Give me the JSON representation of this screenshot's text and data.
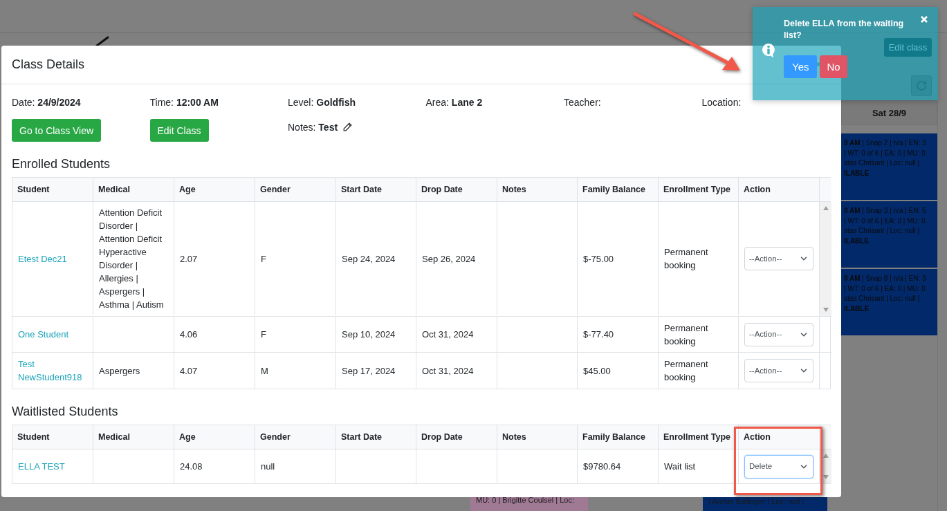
{
  "background": {
    "edit_button": "Edit class",
    "day_header": "Sat 28/9",
    "events": [
      {
        "time": "0 AM",
        "details": "| Snap 2 | n/a | EN: 3",
        "lines": [
          "| WT: 0 of 6 | EA: 0 | MU: 0",
          "stas Chrisant | Loc: null |"
        ],
        "status": "ILABLE",
        "color": "#02296a"
      },
      {
        "time": "0 AM",
        "details": "| Snap 3 | n/a | EN: 5",
        "lines": [
          "| WT: 0 of 6 | EA: 0 | MU: 0",
          "stas Chrisant | Loc: null |"
        ],
        "status": "ILABLE",
        "color": "#02296a"
      },
      {
        "time": "0 AM",
        "details": "| Snap 8 | n/a | EN: 3",
        "lines": [
          "| WT: 0 of 6 | EA: 0 | MU: 0",
          "stas Chrisant | Loc: null |"
        ],
        "status": "ILABLE",
        "color": "#02296a"
      }
    ],
    "bottom_events": [
      {
        "text": "MU: 0 | Brigitte Coulsel | Loc:",
        "color": "#a07a95"
      },
      {
        "text": "| Archie Ballinger | Loc: null |",
        "color": "#02296a"
      }
    ]
  },
  "modal": {
    "title": "Class Details",
    "details": [
      "Date: **24/9/2024**",
      "Time: **12:00 AM**",
      "Level: **Goldfish**",
      "Area: **Lane 2**",
      "Teacher:",
      "Location:"
    ],
    "buttons": [
      "Go to Class View",
      "Edit Class"
    ],
    "notes": "Notes: **Test**",
    "enrolled": {
      "title": "Enrolled Students",
      "columns": [
        "Student",
        "Medical",
        "Age",
        "Gender",
        "Start Date",
        "Drop Date",
        "Notes",
        "Family Balance",
        "Enrollment Type",
        "Action"
      ],
      "rows": [
        {
          "student": "Etest Dec21",
          "medical": "Attention Deficit Disorder | Attention Deficit Hyperactive Disorder | Allergies | Aspergers | Asthma | Autism",
          "age": "2.07",
          "gender": "F",
          "start_date": "Sep 24, 2024",
          "drop_date": "Sep 26, 2024",
          "family_balance": "$-75.00",
          "enrollment_type": "Permanent booking",
          "action": {
            "value": "--Action--",
            "focused": false
          }
        },
        {
          "student": "One Student",
          "age": "4.06",
          "gender": "F",
          "start_date": "Sep 10, 2024",
          "drop_date": "Oct 31, 2024",
          "family_balance": "$-77.40",
          "enrollment_type": "Permanent booking",
          "action": {
            "value": "--Action--",
            "focused": false
          }
        },
        {
          "student": "Test NewStudent918",
          "medical": "Aspergers",
          "age": "4.07",
          "gender": "M",
          "start_date": "Sep 17, 2024",
          "drop_date": "Oct 31, 2024",
          "family_balance": "$45.00",
          "enrollment_type": "Permanent booking",
          "action": {
            "value": "--Action--",
            "focused": false
          }
        }
      ]
    },
    "waitlisted": {
      "title": "Waitlisted Students",
      "columns": [
        "Student",
        "Medical",
        "Age",
        "Gender",
        "Start Date",
        "Drop Date",
        "Notes",
        "Family Balance",
        "Enrollment Type",
        "Action"
      ],
      "rows": [
        {
          "student": "ELLA TEST",
          "age": "24.08",
          "gender": "null",
          "family_balance": "$9780.64",
          "enrollment_type": "Wait list",
          "action": {
            "value": "Delete",
            "focused": true
          }
        }
      ]
    }
  },
  "toast": {
    "message": "Delete ELLA from the waiting list?",
    "buttons": [
      {
        "label": "Yes",
        "kind": "confirm"
      },
      {
        "label": "No",
        "kind": "cancel"
      }
    ]
  }
}
